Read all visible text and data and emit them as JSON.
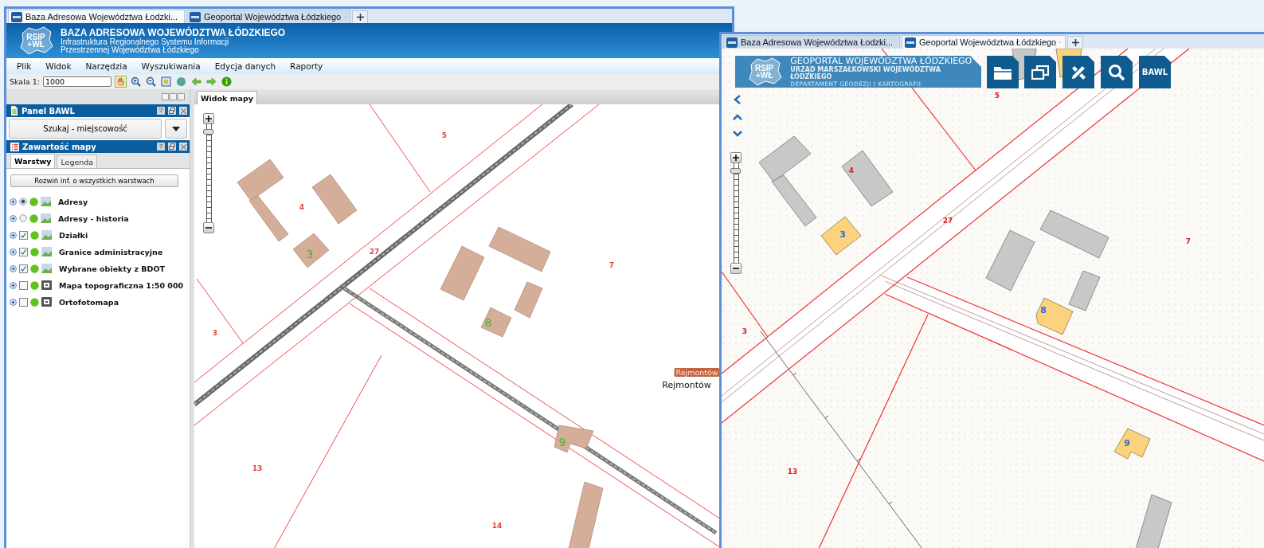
{
  "left_window": {
    "browser_tabs": [
      {
        "title": "Baza Adresowa Województwa Łodzki...",
        "selected": true
      },
      {
        "title": "Geoportal Województwa Łódzkiego",
        "selected": false
      }
    ],
    "header": {
      "logo": [
        "RSIP",
        "+WŁ"
      ],
      "title": "BAZA ADRESOWA WOJEWÓDZTWA ŁÓDZKIEGO",
      "subtitle_lines": [
        "Infrastruktura Regionalnego Systemu Informacji",
        "Przestrzennej Województwa Łódzkiego"
      ]
    },
    "menu": [
      "Plik",
      "Widok",
      "Narzędzia",
      "Wyszukiwania",
      "Edycja danych",
      "Raporty"
    ],
    "toolbar": {
      "scale_label": "Skala 1:",
      "scale_value": "1000",
      "tools": [
        {
          "kind": "pan",
          "selected": true
        },
        {
          "kind": "zoom_in",
          "selected": false
        },
        {
          "kind": "zoom_out",
          "selected": false
        },
        {
          "kind": "extent",
          "selected": false
        },
        {
          "kind": "globe",
          "selected": false
        },
        {
          "kind": "back",
          "selected": false
        },
        {
          "kind": "forward",
          "selected": false
        },
        {
          "kind": "info",
          "selected": false
        }
      ]
    },
    "bawl_panel": {
      "title": "Panel BAWL",
      "help": "?",
      "search_button": "Szukaj - miejscowość"
    },
    "map_contents_panel": {
      "title": "Zawartość mapy",
      "help": "?",
      "tabs": [
        {
          "label": "Warstwy",
          "selected": true
        },
        {
          "label": "Legenda",
          "selected": false
        }
      ],
      "expand_button": "Rozwiń inf. o wszystkich warstwach",
      "layers": [
        {
          "name": "Adresy",
          "kind": "radio",
          "checked": true
        },
        {
          "name": "Adresy - historia",
          "kind": "radio",
          "checked": false
        },
        {
          "name": "Działki",
          "kind": "checkbox",
          "checked": true
        },
        {
          "name": "Granice administracyjne",
          "kind": "checkbox",
          "checked": true
        },
        {
          "name": "Wybrane obiekty z BDOT",
          "kind": "checkbox",
          "checked": true
        },
        {
          "name": "Mapa topograficzna 1:50 000",
          "kind": "service",
          "checked": false
        },
        {
          "name": "Ortofotomapa",
          "kind": "service",
          "checked": false
        }
      ]
    },
    "map": {
      "tab": "Widok mapy",
      "zoom": {
        "level": 0.95
      },
      "labels": [
        {
          "text": "5",
          "kind": "parcel",
          "color": "#e8423c"
        },
        {
          "text": "4",
          "kind": "parcel",
          "color": "#e8423c"
        },
        {
          "text": "3",
          "kind": "address",
          "color": "#4caf30"
        },
        {
          "text": "27",
          "kind": "parcel",
          "color": "#e8423c"
        },
        {
          "text": "7",
          "kind": "parcel",
          "color": "#e8423c"
        },
        {
          "text": "8",
          "kind": "address",
          "color": "#4caf30"
        },
        {
          "text": "3",
          "kind": "parcel",
          "color": "#e8423c"
        },
        {
          "text": "9",
          "kind": "address",
          "color": "#4caf30"
        },
        {
          "text": "13",
          "kind": "parcel",
          "color": "#e8423c"
        },
        {
          "text": "14",
          "kind": "parcel",
          "color": "#e8423c"
        }
      ],
      "place_badge": "Rejmontów",
      "place_name": "Rejmontów"
    }
  },
  "right_window": {
    "browser_tabs": [
      {
        "title": "Baza Adresowa Województwa Łodzki...",
        "selected": false
      },
      {
        "title": "Geoportal Województwa Łódzkiego",
        "selected": true
      }
    ],
    "banner": {
      "logo": [
        "RSIP",
        "+WŁ"
      ],
      "lines": [
        "GEOPORTAL WOJEWÓDZTWA ŁÓDZKIEGO",
        "URZĄD MARSZAŁKOWSKI WOJEWÓDZTWA ŁÓDZKIEGO",
        "DEPARTAMENT GEODEZJI I KARTOGRAFII"
      ]
    },
    "toolbar_buttons": [
      {
        "kind": "folder"
      },
      {
        "kind": "windows"
      },
      {
        "kind": "measure"
      },
      {
        "kind": "search"
      },
      {
        "kind": "text",
        "label": "BAWL"
      }
    ],
    "map": {
      "zoom": {
        "level": 0.95
      },
      "labels": [
        {
          "text": "5",
          "kind": "parcel",
          "color": "#d42020"
        },
        {
          "text": "4",
          "kind": "parcel",
          "color": "#d42020"
        },
        {
          "text": "27",
          "kind": "parcel",
          "color": "#d42020"
        },
        {
          "text": "3",
          "kind": "address",
          "color": "#3366dd"
        },
        {
          "text": "7",
          "kind": "parcel",
          "color": "#d42020"
        },
        {
          "text": "8",
          "kind": "address",
          "color": "#3366dd"
        },
        {
          "text": "3",
          "kind": "parcel",
          "color": "#d42020"
        },
        {
          "text": "9",
          "kind": "address",
          "color": "#3366dd"
        },
        {
          "text": "13",
          "kind": "parcel",
          "color": "#d42020"
        }
      ]
    }
  }
}
